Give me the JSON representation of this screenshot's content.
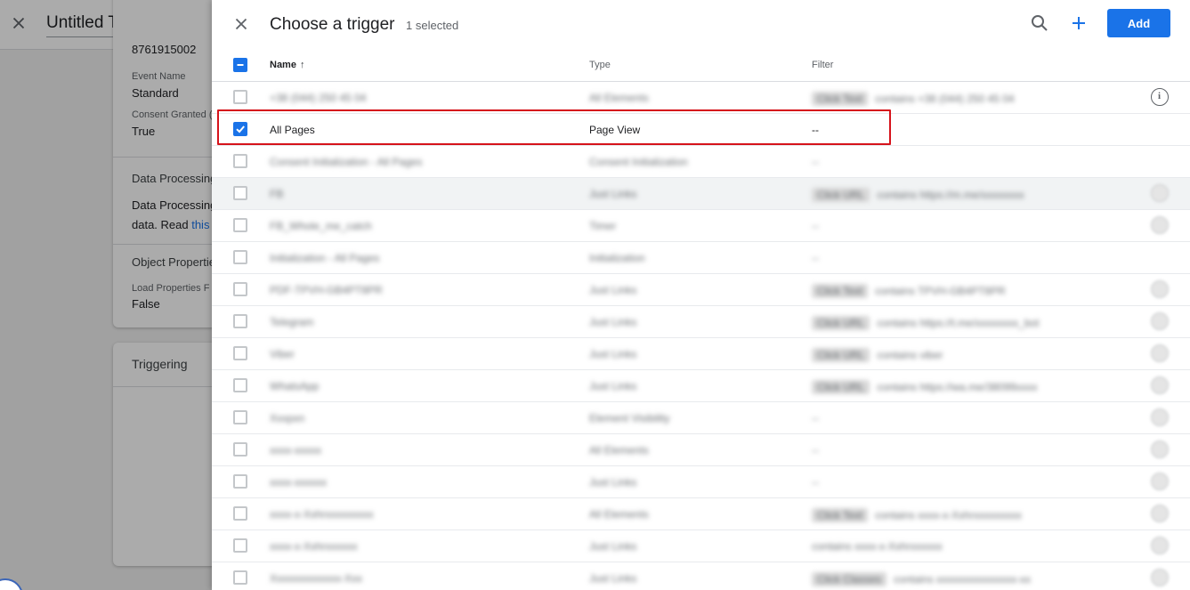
{
  "background": {
    "tag_title": "Untitled Tag",
    "partial_id": "8761915002",
    "fields": [
      {
        "label": "Event Name",
        "value": "Standard"
      },
      {
        "label": "Consent Granted (",
        "value": "True"
      }
    ],
    "data_processing": {
      "heading": "Data Processing",
      "text_line1": "Data Processing",
      "text_line2_prefix": "data. Read ",
      "text_line2_link": "this"
    },
    "object_properties": {
      "heading": "Object Properties",
      "label": "Load Properties F",
      "value": "False"
    },
    "triggering_title": "Triggering"
  },
  "panel": {
    "title": "Choose a trigger",
    "selected_count": "1 selected",
    "add_label": "Add",
    "columns": {
      "name": "Name",
      "type": "Type",
      "filter": "Filter"
    },
    "rows": [
      {
        "name": "+38 (044) 250 45 04",
        "type": "All Elements",
        "chip": "Click Text",
        "filter": "contains +38 (044) 250 45 04",
        "checked": false,
        "blurred": true,
        "info": "outline",
        "shaded": false
      },
      {
        "name": "All Pages",
        "type": "Page View",
        "chip": "",
        "filter": "--",
        "checked": true,
        "blurred": false,
        "info": "",
        "shaded": false
      },
      {
        "name": "Consent Initialization - All Pages",
        "type": "Consent Initialization",
        "chip": "",
        "filter": "--",
        "checked": false,
        "blurred": true,
        "info": "",
        "shaded": false
      },
      {
        "name": "FB",
        "type": "Just Links",
        "chip": "Click URL",
        "filter": "contains https://m.me/xxxxxxxx",
        "checked": false,
        "blurred": true,
        "info": "faded",
        "shaded": true
      },
      {
        "name": "FB_Whole_me_catch",
        "type": "Timer",
        "chip": "",
        "filter": "--",
        "checked": false,
        "blurred": true,
        "info": "faded",
        "shaded": false
      },
      {
        "name": "Initialization - All Pages",
        "type": "Initialization",
        "chip": "",
        "filter": "--",
        "checked": false,
        "blurred": true,
        "info": "",
        "shaded": false
      },
      {
        "name": "PDF-TPVH-GB4PT8PR",
        "type": "Just Links",
        "chip": "Click Text",
        "filter": "contains TPVH-GB4PT8PR",
        "checked": false,
        "blurred": true,
        "info": "faded",
        "shaded": false
      },
      {
        "name": "Telegram",
        "type": "Just Links",
        "chip": "Click URL",
        "filter": "contains https://t.me/xxxxxxxx_bot",
        "checked": false,
        "blurred": true,
        "info": "faded",
        "shaded": false
      },
      {
        "name": "Viber",
        "type": "Just Links",
        "chip": "Click URL",
        "filter": "contains viber",
        "checked": false,
        "blurred": true,
        "info": "faded",
        "shaded": false
      },
      {
        "name": "WhatsApp",
        "type": "Just Links",
        "chip": "Click URL",
        "filter": "contains https://wa.me/38099xxxx",
        "checked": false,
        "blurred": true,
        "info": "faded",
        "shaded": false
      },
      {
        "name": "Xxxpxn",
        "type": "Element Visibility",
        "chip": "",
        "filter": "--",
        "checked": false,
        "blurred": true,
        "info": "faded",
        "shaded": false
      },
      {
        "name": "xxxx-xxxxx",
        "type": "All Elements",
        "chip": "",
        "filter": "--",
        "checked": false,
        "blurred": true,
        "info": "faded",
        "shaded": false
      },
      {
        "name": "xxxx-xxxxxx",
        "type": "Just Links",
        "chip": "",
        "filter": "--",
        "checked": false,
        "blurred": true,
        "info": "faded",
        "shaded": false
      },
      {
        "name": "xxxx-x-Xxhrxxxxxxxxx",
        "type": "All Elements",
        "chip": "Click Text",
        "filter": "contains xxxx-x-Xxhrxxxxxxxxx",
        "checked": false,
        "blurred": true,
        "info": "faded",
        "shaded": false
      },
      {
        "name": "xxxx-x-Xxhrxxxxxx",
        "type": "Just Links",
        "chip": "",
        "filter": "contains xxxx-x-Xxhrxxxxxx",
        "checked": false,
        "blurred": true,
        "info": "faded",
        "shaded": false
      },
      {
        "name": "Xxxxxxxxxxxxx-Xxx",
        "type": "Just Links",
        "chip": "Click Classes",
        "filter": "contains xxxxxxxxxxxxxxx-xx",
        "checked": false,
        "blurred": true,
        "info": "faded",
        "shaded": false
      }
    ]
  },
  "colors": {
    "accent": "#1a73e8",
    "highlight": "#d6131b"
  },
  "icons": {
    "close": "close-icon",
    "folder": "folder-icon",
    "search": "search-icon",
    "add": "plus-icon",
    "sort": "arrow-up-icon",
    "info": "info-icon",
    "check": "checkmark-icon"
  }
}
